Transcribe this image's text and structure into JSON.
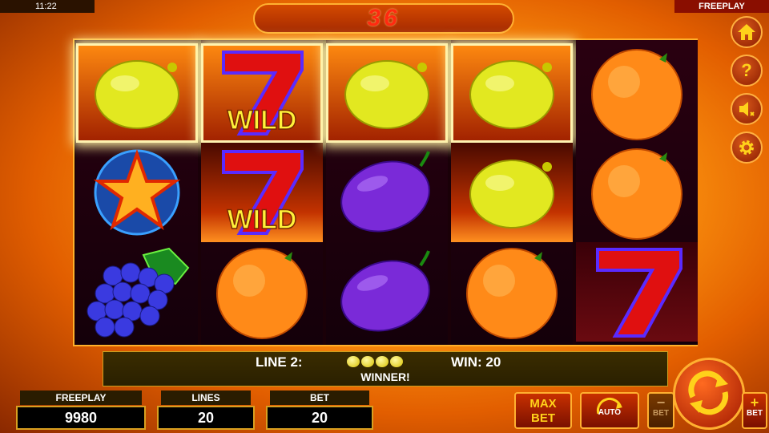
{
  "status": {
    "time": "11:22",
    "mode": "FREEPLAY"
  },
  "counter": "36",
  "side_buttons": [
    {
      "icon": "home-icon"
    },
    {
      "icon": "help-icon",
      "label": "?"
    },
    {
      "icon": "sound-off-icon"
    },
    {
      "icon": "gear-icon"
    }
  ],
  "reels": [
    [
      "lemon",
      "star",
      "grapes"
    ],
    [
      "seven-wild",
      "seven-wild",
      "orange"
    ],
    [
      "lemon",
      "plum",
      "plum"
    ],
    [
      "lemon",
      "lemon",
      "orange"
    ],
    [
      "orange",
      "orange",
      "seven"
    ]
  ],
  "wild_label": "WILD",
  "win": {
    "line_label": "LINE 2:",
    "coins": 4,
    "win_label": "WIN: 20",
    "message": "WINNER!"
  },
  "panels": {
    "freeplay": {
      "label": "FREEPLAY",
      "value": "9980"
    },
    "lines": {
      "label": "LINES",
      "value": "20"
    },
    "bet": {
      "label": "BET",
      "value": "20"
    }
  },
  "buttons": {
    "max_bet_1": "MAX",
    "max_bet_2": "BET",
    "auto": "AUTO",
    "bet_minus": "BET",
    "bet_plus": "BET"
  },
  "colors": {
    "accent": "#ffb030",
    "counter_text": "#ff2a10",
    "lemon": "#e2e820",
    "orange": "#ff8a18",
    "plum": "#7a2ad8"
  }
}
